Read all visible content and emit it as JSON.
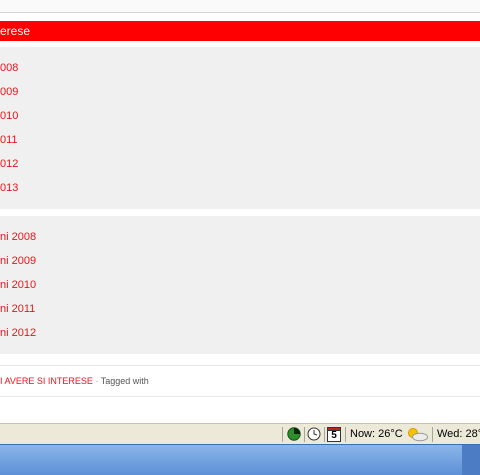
{
  "header": {
    "label": "erese"
  },
  "panel_years": [
    {
      "label": "008"
    },
    {
      "label": "009"
    },
    {
      "label": "010"
    },
    {
      "label": "011"
    },
    {
      "label": "012"
    },
    {
      "label": "013"
    }
  ],
  "panel_ani": [
    {
      "label": "ni 2008"
    },
    {
      "label": "ni 2009"
    },
    {
      "label": "ni 2010"
    },
    {
      "label": "ni 2011"
    },
    {
      "label": "ni 2012"
    }
  ],
  "footer": {
    "category": "I AVERE SI INTERESE",
    "separator": "·",
    "tagged": "Tagged with"
  },
  "statusbar": {
    "weather_now": "Now: 26°C",
    "weather_wed": "Wed: 28°",
    "calendar_day": "5"
  },
  "colors": {
    "accent_red": "#ff0000",
    "link_red": "#e8151b",
    "panel_gray": "#f0f0f0"
  }
}
